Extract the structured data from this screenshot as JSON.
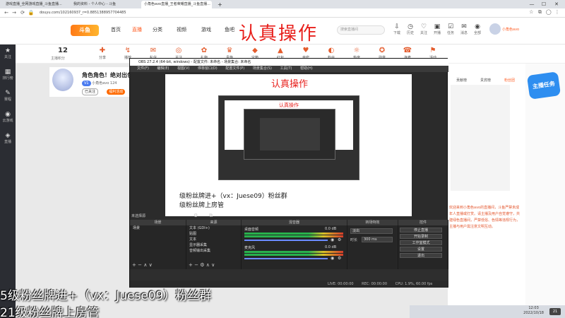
{
  "browser": {
    "tabs": [
      "游戏直播_全网游戏直播_斗鱼直播...",
      "我的资料 - 个人中心 - 斗鱼",
      "小角色avo直播_王者荣耀直播_斗鱼直播..."
    ],
    "url": "douyu.com/102160937_r=0.8851388957704485",
    "win_controls": [
      "—",
      "☐",
      "✕"
    ]
  },
  "overlay_title": "认真操作",
  "header": {
    "logo": "斗鱼",
    "nav": [
      "首页",
      "直播",
      "分类",
      "视频",
      "游戏",
      "鱼吧"
    ],
    "active_nav": "直播",
    "search_placeholder": "搜索直播间",
    "icons": [
      {
        "icon": "download-icon",
        "label": "下载"
      },
      {
        "icon": "history-icon",
        "label": "历史"
      },
      {
        "icon": "follow-icon",
        "label": "关注"
      },
      {
        "icon": "dev-icon",
        "label": "开播"
      },
      {
        "icon": "task-icon",
        "label": "任务"
      },
      {
        "icon": "msg-icon",
        "label": "消息"
      },
      {
        "icon": "ai-icon",
        "label": "全部"
      }
    ],
    "user": {
      "name": "小角色avo"
    }
  },
  "leftbar": [
    {
      "icon": "★",
      "label": "关注"
    },
    {
      "icon": "▦",
      "label": "排行榜"
    },
    {
      "icon": "✎",
      "label": "赛程"
    },
    {
      "icon": "◉",
      "label": "云游戏"
    },
    {
      "icon": "◈",
      "label": "直播"
    }
  ],
  "category": {
    "count": "12",
    "count_label": "主播积分",
    "items": [
      {
        "icon": "✚",
        "label": "分享"
      },
      {
        "icon": "↯",
        "label": "播放"
      },
      {
        "icon": "✉",
        "label": "私信"
      },
      {
        "icon": "◎",
        "label": "关注"
      },
      {
        "icon": "✿",
        "label": "礼物"
      },
      {
        "icon": "♛",
        "label": "贵族"
      },
      {
        "icon": "◆",
        "label": "宝箱"
      },
      {
        "icon": "▲",
        "label": "红包"
      },
      {
        "icon": "♥",
        "label": "亲密"
      },
      {
        "icon": "◐",
        "label": "粉丝"
      },
      {
        "icon": "☼",
        "label": "热度"
      },
      {
        "icon": "✪",
        "label": "勋章"
      },
      {
        "icon": "☎",
        "label": "连麦"
      },
      {
        "icon": "⚑",
        "label": "活动"
      }
    ]
  },
  "banner": {
    "title": "角色角色！绝对出色",
    "tag1": "小角色avo",
    "tag2": "124",
    "btn1": "已关注",
    "btn2": "福利活动"
  },
  "obs": {
    "title": "OBS 27.2.4 (64-bit, windows) - 配置文件: 未命名 - 场景集合: 未命名",
    "menu": [
      "文件(F)",
      "编辑(E)",
      "视图(V)",
      "停靠窗口(D)",
      "配置文件(P)",
      "场景集合(S)",
      "工具(T)",
      "帮助(H)"
    ],
    "preview_title": "认真操作",
    "preview_subtitle": "认真操作",
    "preview_overlay1": "级粉丝牌进+（vx：Juese09）粉丝群",
    "preview_overlay2": "级粉丝牌上房管",
    "source_none": "未选择源",
    "panels": {
      "scenes": {
        "title": "场景",
        "items": [
          "场景"
        ]
      },
      "sources": {
        "title": "来源",
        "items": [
          "文本 (GDI+)",
          "贴图",
          "文本",
          "显示器采集",
          "音频输出采集"
        ]
      },
      "mixer": {
        "title": "混音器",
        "channels": [
          {
            "name": "桌面音频",
            "level": "0.0 dB"
          },
          {
            "name": "麦克风",
            "level": "0.0 dB"
          }
        ]
      },
      "transitions": {
        "title": "转场特效",
        "type": "淡出",
        "duration_label": "时长",
        "duration": "300 ms"
      },
      "controls": {
        "title": "控件",
        "buttons": [
          "停止直播",
          "开始录制",
          "工作室模式",
          "设置",
          "退出"
        ]
      }
    },
    "status": {
      "live": "LIVE: 00:00:00",
      "rec": "REC: 00:00:00",
      "cpu": "CPU: 1.9%, 60.00 fps"
    }
  },
  "right": {
    "tabs": [
      "贡献榜",
      "贵宾榜",
      "粉丝团"
    ],
    "badge_text": "主播任务",
    "chat_text": "欢迎来到小角色avo的直播间，斗鱼严禁未成年人直播或打赏。请主播及用户自觉遵守，共建绿色直播间，严禁低俗、色情等违规行为，主播与用户需注意文明互动。"
  },
  "overlays": {
    "line1": "5级粉丝牌进+（vx：Juese09）粉丝群",
    "line2": "21级粉丝牌上房管"
  },
  "taskbar": {
    "time": "12:03",
    "date": "2022/10/18",
    "notif": "21"
  }
}
